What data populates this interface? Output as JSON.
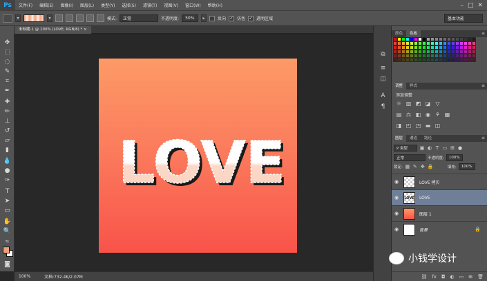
{
  "app": {
    "logo": "Ps",
    "menus": [
      "文件(F)",
      "编辑(E)",
      "图像(I)",
      "图层(L)",
      "类型(Y)",
      "选择(S)",
      "滤镜(T)",
      "视图(V)",
      "窗口(W)",
      "帮助(H)"
    ],
    "window_controls": [
      "–",
      "□",
      "✕"
    ]
  },
  "options": {
    "mode_label": "模式:",
    "mode_value": "正常",
    "opacity_label": "不透明度:",
    "opacity_value": "50%",
    "reverse_label": "反向",
    "dither_label": "仿色",
    "transparency_label": "透明区域",
    "workspace": "基本功能"
  },
  "document": {
    "tab_title": "未标题-1 @ 100% (LOVE, RGB/8) *  ×",
    "artwork_text": "LOVE"
  },
  "status": {
    "zoom": "100%",
    "doc_info": "文档:732.4K/2.07M"
  },
  "panels": {
    "color_tabs": [
      "颜色",
      "色板"
    ],
    "adjust_tabs": [
      "调整",
      "样式"
    ],
    "adjust_title": "添加调整",
    "layer_tabs": [
      "图层",
      "通道",
      "路径"
    ],
    "kind_label": "P 类型",
    "blend_mode": "正常",
    "opacity_label": "不透明度:",
    "opacity_value": "100%",
    "lock_label": "锁定:",
    "fill_label": "填充:",
    "fill_value": "100%"
  },
  "layers": [
    {
      "name": "LOVE 拷贝",
      "selected": false
    },
    {
      "name": "LOVE",
      "selected": true
    },
    {
      "name": "图层 1",
      "selected": false
    },
    {
      "name": "背景",
      "selected": false
    }
  ],
  "watermark": "小钱学设计",
  "colors": {
    "foreground": "#f3a07a",
    "background": "#ffffff",
    "gradient_top": "#fd9a66",
    "gradient_bottom": "#f9534a",
    "selected_layer": "#6f7f97"
  }
}
